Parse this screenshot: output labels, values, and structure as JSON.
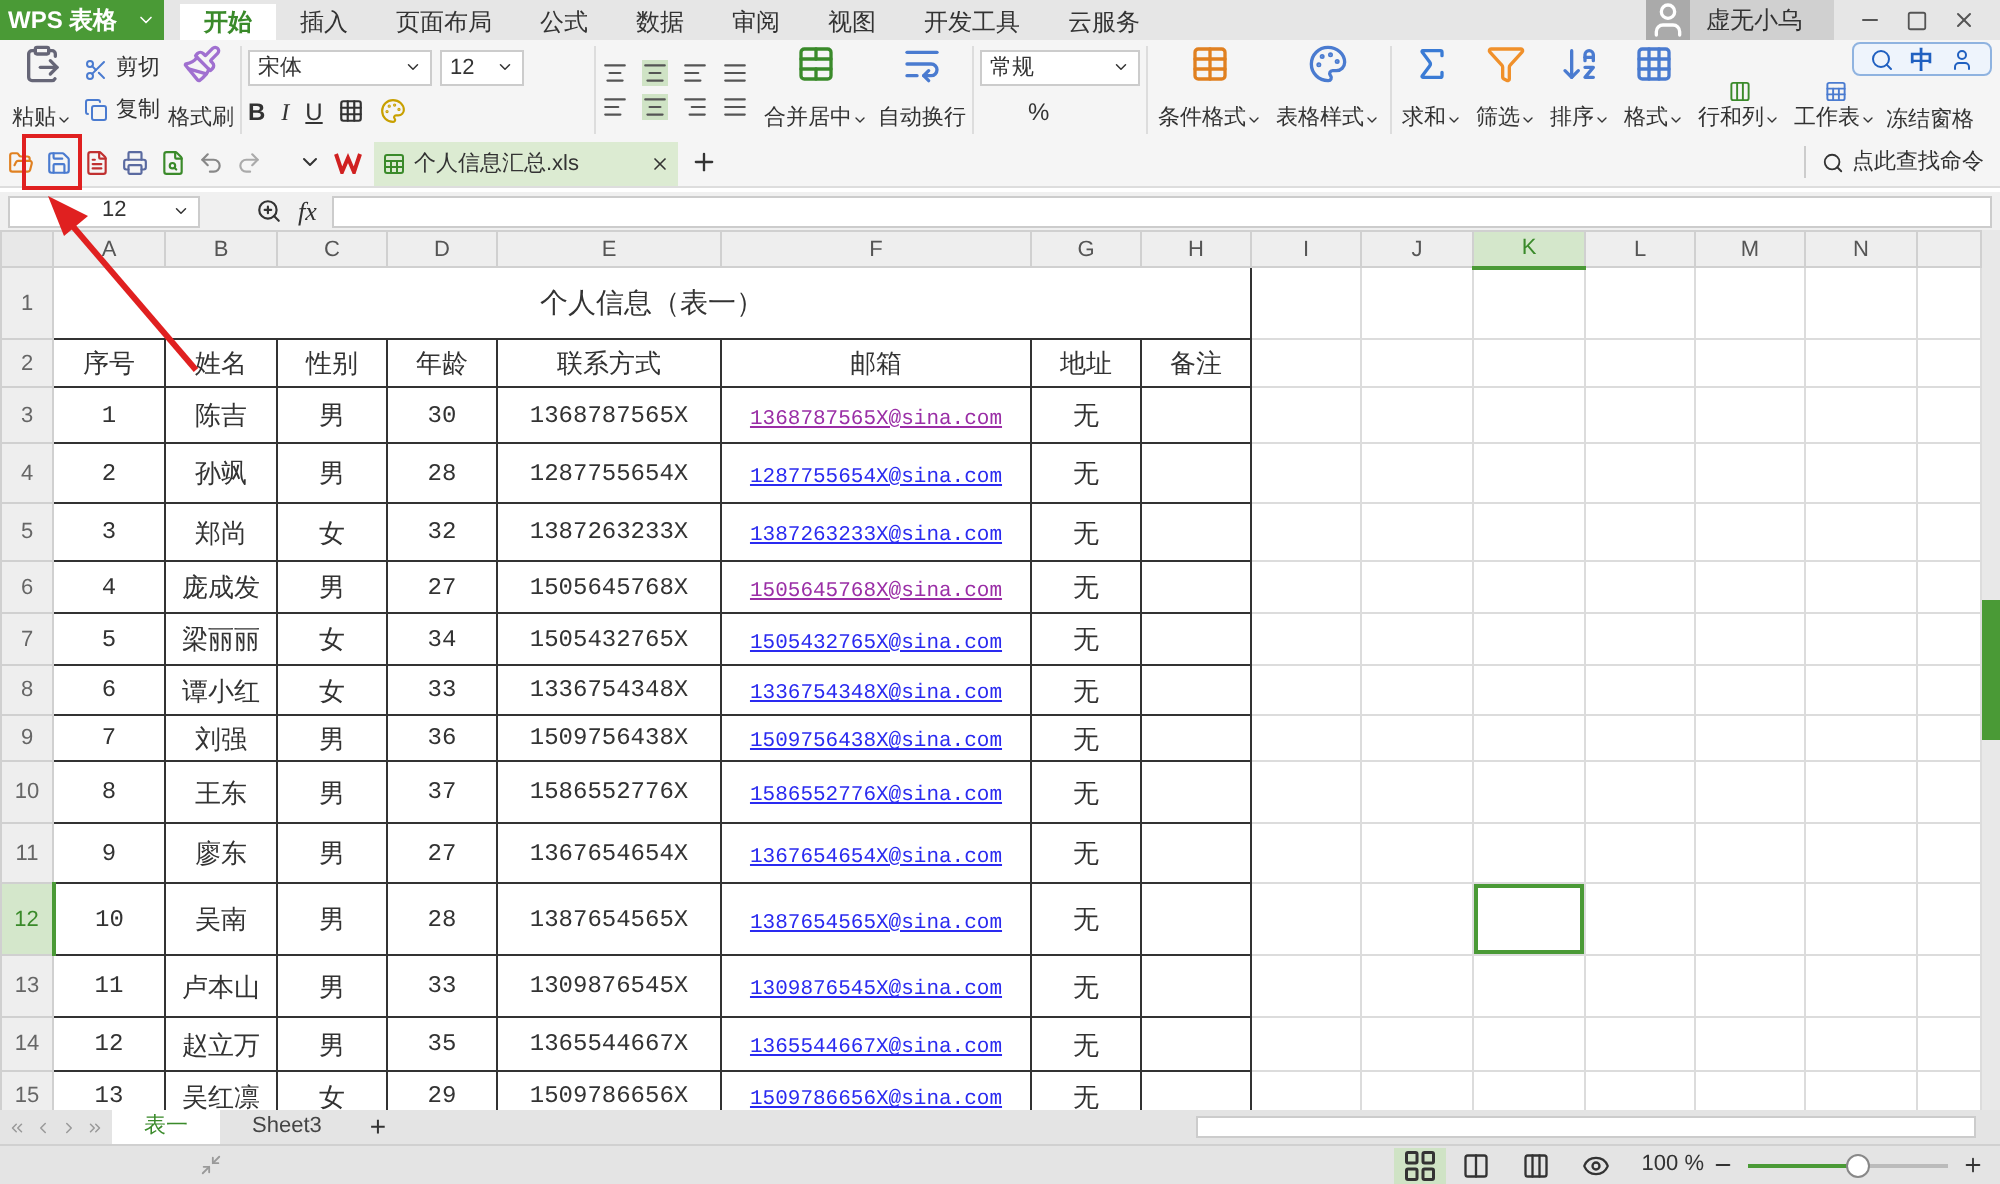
{
  "app": {
    "logo": "WPS 表格"
  },
  "menu_tabs": [
    {
      "label": "开始",
      "selected": true
    },
    {
      "label": "插入",
      "selected": false
    },
    {
      "label": "页面布局",
      "selected": false
    },
    {
      "label": "公式",
      "selected": false
    },
    {
      "label": "数据",
      "selected": false
    },
    {
      "label": "审阅",
      "selected": false
    },
    {
      "label": "视图",
      "selected": false
    },
    {
      "label": "开发工具",
      "selected": false
    },
    {
      "label": "云服务",
      "selected": false
    }
  ],
  "account": {
    "name": "虚无小乌"
  },
  "ribbon": {
    "paste": "粘贴",
    "cut": "剪切",
    "copy": "复制",
    "format_painter": "格式刷",
    "font": "宋体",
    "font_size": "12",
    "bold": "B",
    "italic": "I",
    "underline": "U",
    "merge": "合并居中",
    "wrap": "自动换行",
    "number_format": "常规",
    "percent": "%",
    "conditional": "条件格式",
    "table_style": "表格样式",
    "sum": "求和",
    "filter": "筛选",
    "sort": "排序",
    "format": "格式",
    "rows_cols": "行和列",
    "worksheet": "工作表",
    "freeze": "冻结窗格"
  },
  "ime_toolbar": {
    "mode": "中"
  },
  "document_tab": {
    "title": "个人信息汇总.xls"
  },
  "command_search": {
    "placeholder": "点此查找命令"
  },
  "formula_bar": {
    "cell": "12",
    "fx": "fx"
  },
  "sheet": {
    "columns": [
      {
        "label": "A",
        "selected": false
      },
      {
        "label": "B",
        "selected": false
      },
      {
        "label": "C",
        "selected": false
      },
      {
        "label": "D",
        "selected": false
      },
      {
        "label": "E",
        "selected": false
      },
      {
        "label": "F",
        "selected": false
      },
      {
        "label": "G",
        "selected": false
      },
      {
        "label": "H",
        "selected": false
      },
      {
        "label": "I",
        "selected": false
      },
      {
        "label": "J",
        "selected": false
      },
      {
        "label": "K",
        "selected": true
      },
      {
        "label": "L",
        "selected": false
      },
      {
        "label": "M",
        "selected": false
      },
      {
        "label": "N",
        "selected": false
      }
    ],
    "rows": [
      {
        "num": "1",
        "selected": false,
        "kind": "title",
        "text": "个人信息（表一）"
      },
      {
        "num": "2",
        "selected": false,
        "kind": "header",
        "cells": [
          "序号",
          "姓名",
          "性别",
          "年龄",
          "联系方式",
          "邮箱",
          "地址",
          "备注"
        ]
      },
      {
        "num": "3",
        "selected": false,
        "kind": "data",
        "cells": [
          "1",
          "陈吉",
          "男",
          "30",
          "1368787565X"
        ],
        "email": {
          "text": "1368787565X@sina.com",
          "visited": true
        },
        "address": "无"
      },
      {
        "num": "4",
        "selected": false,
        "kind": "data",
        "cells": [
          "2",
          "孙飒",
          "男",
          "28",
          "1287755654X"
        ],
        "email": {
          "text": "1287755654X@sina.com",
          "visited": false
        },
        "address": "无"
      },
      {
        "num": "5",
        "selected": false,
        "kind": "data",
        "cells": [
          "3",
          "郑尚",
          "女",
          "32",
          "1387263233X"
        ],
        "email": {
          "text": "1387263233X@sina.com",
          "visited": false
        },
        "address": "无"
      },
      {
        "num": "6",
        "selected": false,
        "kind": "data",
        "cells": [
          "4",
          "庞成发",
          "男",
          "27",
          "1505645768X"
        ],
        "email": {
          "text": "1505645768X@sina.com",
          "visited": true
        },
        "address": "无"
      },
      {
        "num": "7",
        "selected": false,
        "kind": "data",
        "cells": [
          "5",
          "梁丽丽",
          "女",
          "34",
          "1505432765X"
        ],
        "email": {
          "text": "1505432765X@sina.com",
          "visited": false
        },
        "address": "无"
      },
      {
        "num": "8",
        "selected": false,
        "kind": "data",
        "cells": [
          "6",
          "谭小红",
          "女",
          "33",
          "1336754348X"
        ],
        "email": {
          "text": "1336754348X@sina.com",
          "visited": false
        },
        "address": "无"
      },
      {
        "num": "9",
        "selected": false,
        "kind": "data",
        "cells": [
          "7",
          "刘强",
          "男",
          "36",
          "1509756438X"
        ],
        "email": {
          "text": "1509756438X@sina.com",
          "visited": false
        },
        "address": "无"
      },
      {
        "num": "10",
        "selected": false,
        "kind": "data",
        "cells": [
          "8",
          "王东",
          "男",
          "37",
          "1586552776X"
        ],
        "email": {
          "text": "1586552776X@sina.com",
          "visited": false
        },
        "address": "无"
      },
      {
        "num": "11",
        "selected": false,
        "kind": "data",
        "cells": [
          "9",
          "廖东",
          "男",
          "27",
          "1367654654X"
        ],
        "email": {
          "text": "1367654654X@sina.com",
          "visited": false
        },
        "address": "无"
      },
      {
        "num": "12",
        "selected": true,
        "kind": "data",
        "cells": [
          "10",
          "吴南",
          "男",
          "28",
          "1387654565X"
        ],
        "email": {
          "text": "1387654565X@sina.com",
          "visited": false
        },
        "address": "无"
      },
      {
        "num": "13",
        "selected": false,
        "kind": "data",
        "cells": [
          "11",
          "卢本山",
          "男",
          "33",
          "1309876545X"
        ],
        "email": {
          "text": "1309876545X@sina.com",
          "visited": false
        },
        "address": "无"
      },
      {
        "num": "14",
        "selected": false,
        "kind": "data",
        "cells": [
          "12",
          "赵立万",
          "男",
          "35",
          "1365544667X"
        ],
        "email": {
          "text": "1365544667X@sina.com",
          "visited": false
        },
        "address": "无"
      },
      {
        "num": "15",
        "selected": false,
        "kind": "data",
        "cells": [
          "13",
          "吴红凛",
          "女",
          "29",
          "1509786656X"
        ],
        "email": {
          "text": "1509786656X@sina.com",
          "visited": false
        },
        "address": "无"
      }
    ]
  },
  "sheet_tabs": [
    {
      "label": "表一",
      "selected": true
    },
    {
      "label": "Sheet3",
      "selected": false
    }
  ],
  "add_sheet": "+",
  "status_bar": {
    "zoom": "100 %",
    "zoom_slider": {
      "level": 0.55
    }
  }
}
